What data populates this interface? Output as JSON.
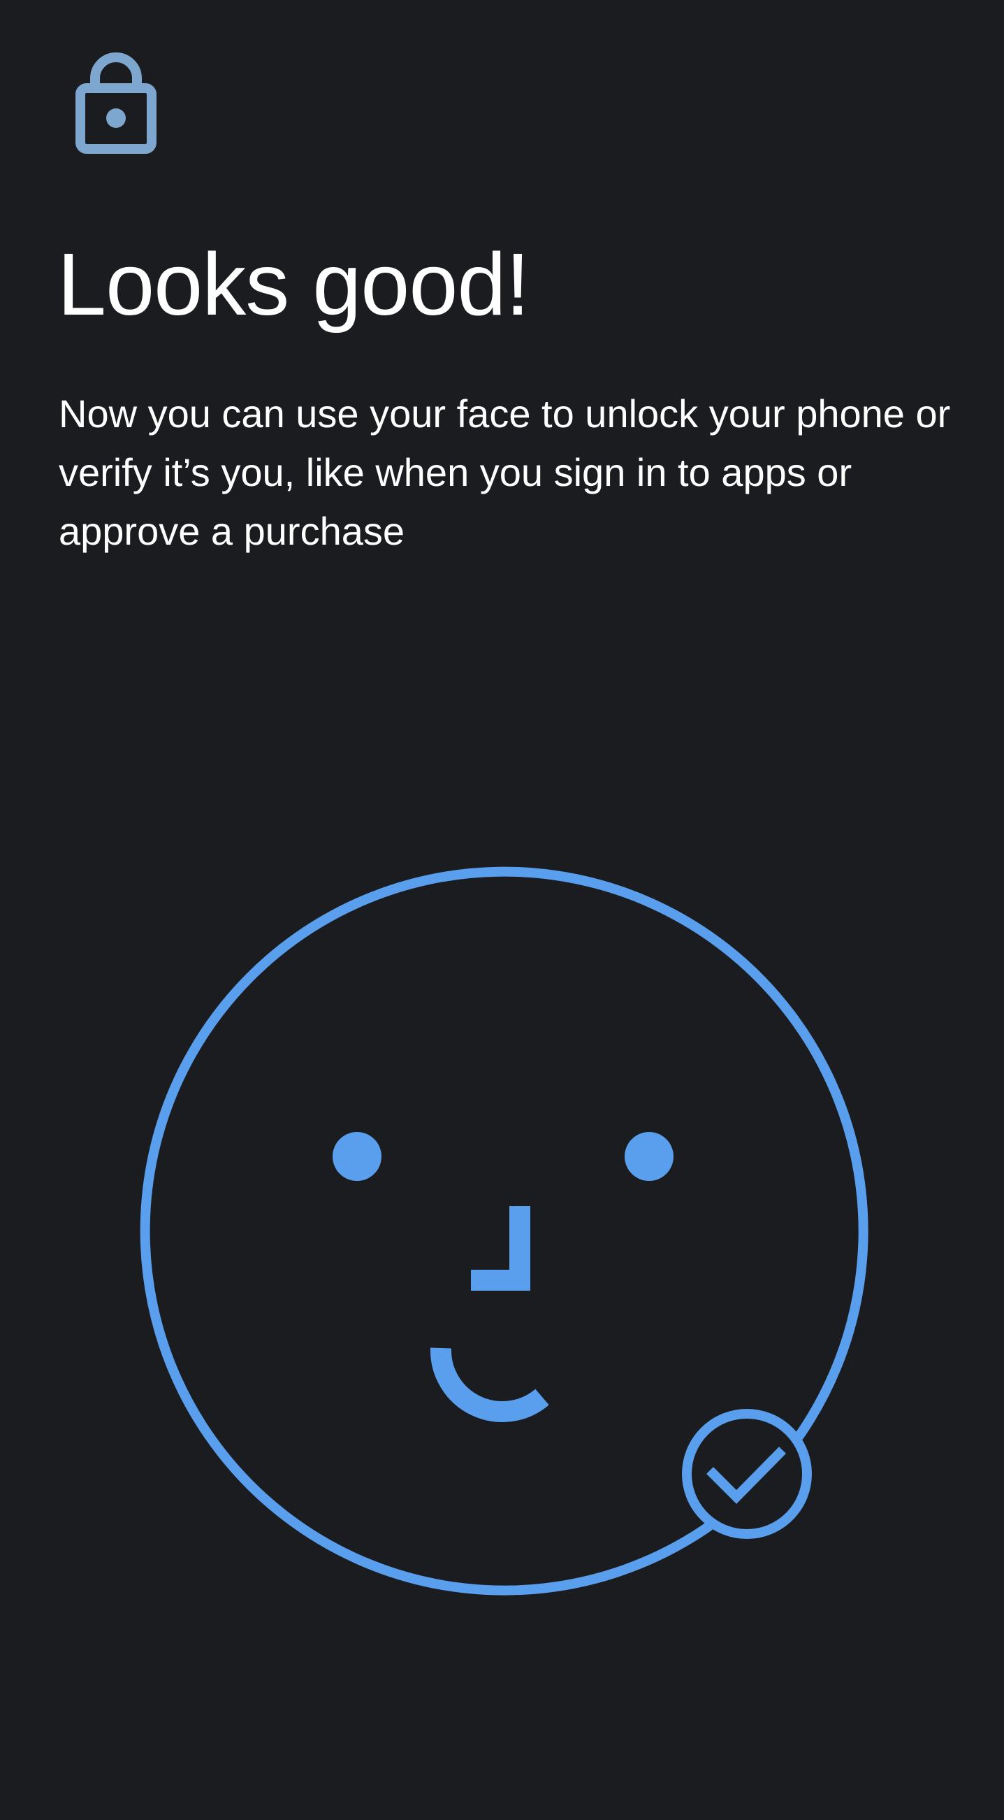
{
  "header": {
    "icon": "lock-icon"
  },
  "title": "Looks good!",
  "description": "Now you can use your face to unlock your phone or verify it’s you, like when you sign in to apps or approve a purchase",
  "illustration": {
    "icon": "face-with-check-icon"
  },
  "colors": {
    "background": "#1a1c1f",
    "accent": "#5a9eee",
    "lock": "#7ea7cf",
    "text": "#ffffff"
  }
}
